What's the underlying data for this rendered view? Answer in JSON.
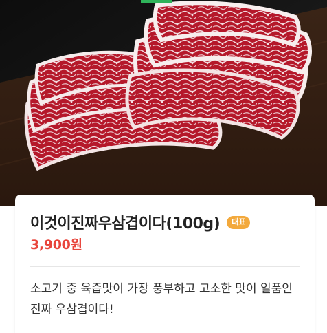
{
  "product": {
    "image_alt_icon": "marbled-beef-slices-image",
    "title": "이것이진짜우삼겹이다(100g)",
    "badge": "대표",
    "price": "3,900원",
    "description": "소고기 중 육즙맛이 가장 풍부하고 고소한 맛이 일품인 진짜 우삼겹이다!"
  },
  "colors": {
    "price": "#e8453c",
    "badge": "#f3a93c",
    "indicator": "#2fb35a"
  }
}
